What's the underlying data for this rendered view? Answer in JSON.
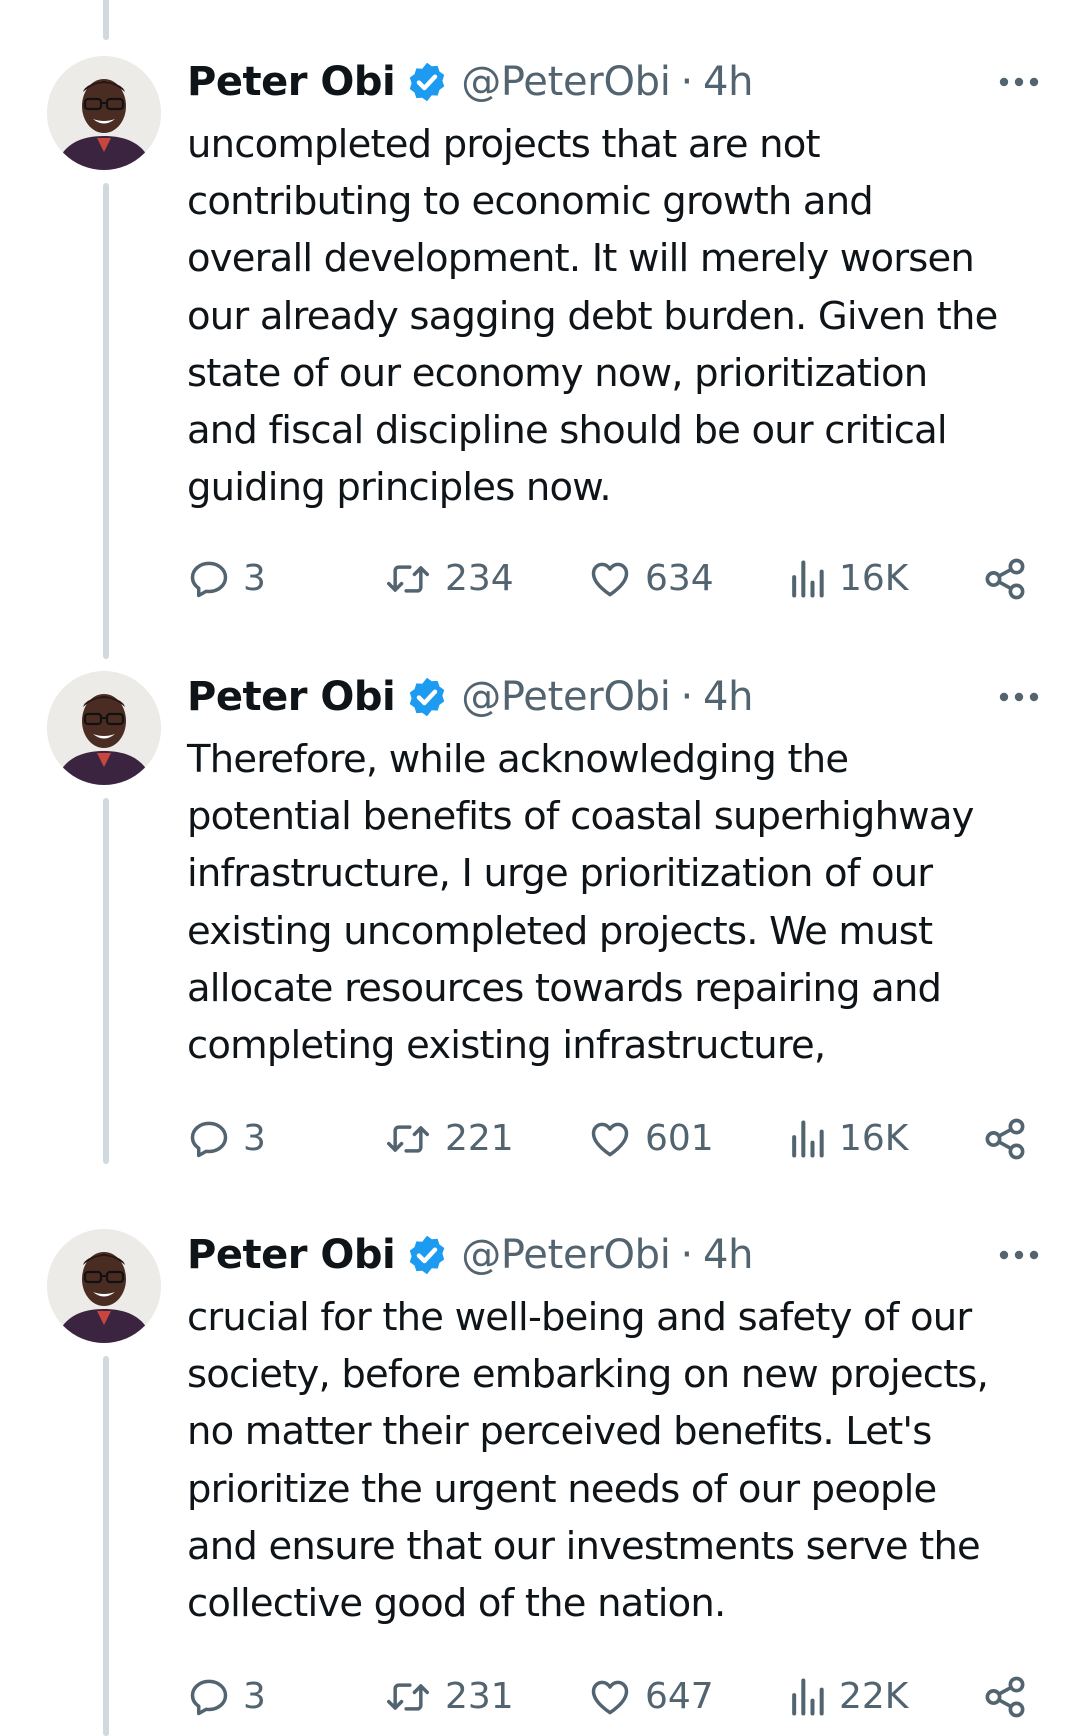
{
  "colors": {
    "text_primary": "#0f1419",
    "text_secondary": "#536471",
    "verified_badge": "#1d9bf0",
    "thread_line": "#cfd9de"
  },
  "icons": {
    "reply": "speech-bubble",
    "retweet": "two-arrows-loop",
    "like": "heart-outline",
    "views": "bar-chart",
    "share": "share-nodes",
    "more": "three-dots",
    "verified": "check-badge"
  },
  "tweets": [
    {
      "author": {
        "name": "Peter Obi",
        "handle": "@PeterObi",
        "separator": "·",
        "time": "4h"
      },
      "lines": [
        "uncompleted projects that are not",
        "contributing to economic growth and",
        "overall development. It will merely worsen",
        "our already sagging debt burden. Given the",
        "state of our economy now, prioritization",
        "and fiscal discipline should be our critical",
        "guiding principles now."
      ],
      "stats": {
        "replies": "3",
        "retweets": "234",
        "likes": "634",
        "views": "16K"
      }
    },
    {
      "author": {
        "name": "Peter Obi",
        "handle": "@PeterObi",
        "separator": "·",
        "time": "4h"
      },
      "lines": [
        "Therefore, while acknowledging the",
        "potential benefits of coastal superhighway",
        "infrastructure, I urge prioritization of our",
        "existing uncompleted projects. We must",
        "allocate resources towards repairing and",
        "completing existing infrastructure,"
      ],
      "stats": {
        "replies": "3",
        "retweets": "221",
        "likes": "601",
        "views": "16K"
      }
    },
    {
      "author": {
        "name": "Peter Obi",
        "handle": "@PeterObi",
        "separator": "·",
        "time": "4h"
      },
      "lines": [
        "crucial for the well-being and safety of our",
        "society, before embarking on new projects,",
        "no matter their perceived benefits. Let's",
        "prioritize the urgent needs of our people",
        "and ensure that our investments serve the",
        "collective good of the nation."
      ],
      "stats": {
        "replies": "3",
        "retweets": "231",
        "likes": "647",
        "views": "22K"
      }
    }
  ]
}
